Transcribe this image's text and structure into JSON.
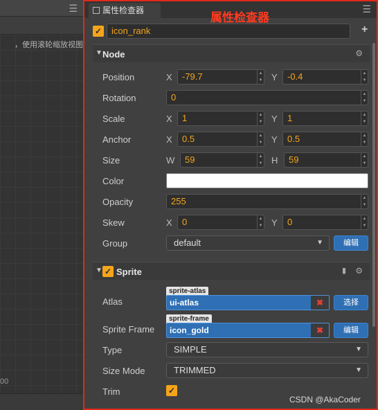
{
  "left_panel": {
    "hint": "，使用滚轮缩放视图",
    "coord": "00"
  },
  "inspector": {
    "tab_title": "属性检查器",
    "annotation": "属性检查器",
    "node_name": "icon_rank",
    "node_enabled": true
  },
  "node_section": {
    "title": "Node",
    "position": {
      "label": "Position",
      "x_axis": "X",
      "x": "-79.7",
      "y_axis": "Y",
      "y": "-0.4"
    },
    "rotation": {
      "label": "Rotation",
      "value": "0"
    },
    "scale": {
      "label": "Scale",
      "x_axis": "X",
      "x": "1",
      "y_axis": "Y",
      "y": "1"
    },
    "anchor": {
      "label": "Anchor",
      "x_axis": "X",
      "x": "0.5",
      "y_axis": "Y",
      "y": "0.5"
    },
    "size": {
      "label": "Size",
      "w_axis": "W",
      "w": "59",
      "h_axis": "H",
      "h": "59"
    },
    "color": {
      "label": "Color",
      "value": "#ffffff"
    },
    "opacity": {
      "label": "Opacity",
      "value": "255"
    },
    "skew": {
      "label": "Skew",
      "x_axis": "X",
      "x": "0",
      "y_axis": "Y",
      "y": "0"
    },
    "group": {
      "label": "Group",
      "value": "default",
      "edit_button": "编辑"
    }
  },
  "sprite_section": {
    "title": "Sprite",
    "enabled": true,
    "atlas": {
      "label": "Atlas",
      "tag": "sprite-atlas",
      "value": "ui-atlas",
      "select_button": "选择"
    },
    "sprite_frame": {
      "label": "Sprite Frame",
      "tag": "sprite-frame",
      "value": "icon_gold",
      "edit_button": "编辑"
    },
    "type": {
      "label": "Type",
      "value": "SIMPLE"
    },
    "size_mode": {
      "label": "Size Mode",
      "value": "TRIMMED"
    },
    "trim": {
      "label": "Trim",
      "checked": true
    }
  },
  "watermark": "CSDN @AkaCoder",
  "colors": {
    "accent": "#f5a51a",
    "highlight_border": "#e02a18",
    "button_blue": "#2f6fb4"
  }
}
